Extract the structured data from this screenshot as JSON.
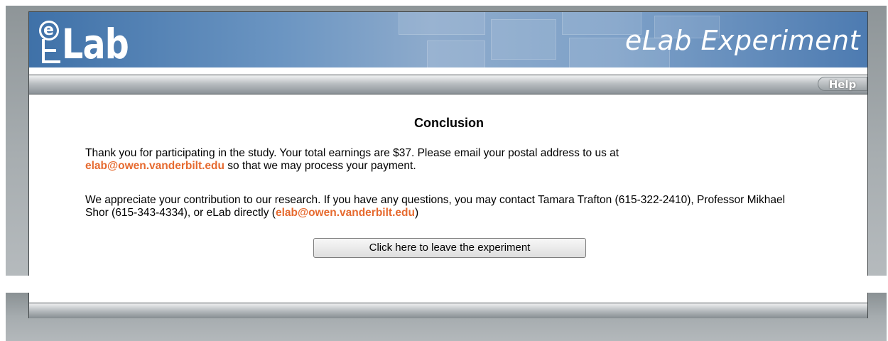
{
  "header": {
    "logo_text": "Lab",
    "logo_icon": "elab-e-logo",
    "title": "eLab Experiment"
  },
  "toolbar": {
    "help_label": "Help"
  },
  "main": {
    "heading": "Conclusion",
    "paragraph1": {
      "text_before": "Thank you for participating in the study. Your total earnings are $37. Please email your postal address to us at",
      "email": "elab@owen.vanderbilt.edu",
      "text_after": " so that we may process your payment."
    },
    "paragraph2": {
      "text_before": "We appreciate your contribution to our research. If you have any questions, you may contact Tamara Trafton (615-322-2410), Professor Mikhael Shor (615-343-4334), or eLab directly (",
      "email": "elab@owen.vanderbilt.edu",
      "text_after": ")"
    },
    "leave_button_label": "Click here to leave the experiment"
  },
  "colors": {
    "header_blue": "#4d7bb1",
    "link_orange": "#e66a2f",
    "frame_gray": "#a7adb0"
  }
}
